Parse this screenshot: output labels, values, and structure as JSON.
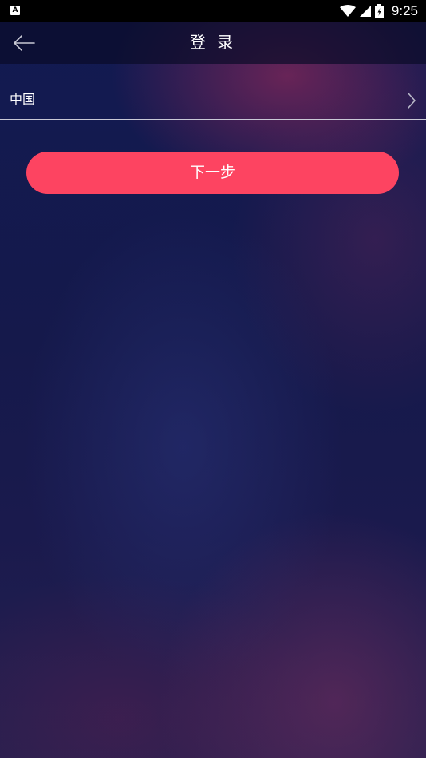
{
  "status_bar": {
    "app_icon_letter": "A",
    "time": "9:25",
    "icons": [
      "wifi-icon",
      "cell-signal-icon",
      "battery-icon"
    ]
  },
  "header": {
    "back_icon": "arrow-left-icon",
    "title": "登 录"
  },
  "country_selector": {
    "value": "中国",
    "icon": "chevron-right-icon"
  },
  "next_button": {
    "label": "下一步"
  },
  "colors": {
    "accent": "#fd4461",
    "background": "#141a4d",
    "divider": "#c9c9d6"
  }
}
